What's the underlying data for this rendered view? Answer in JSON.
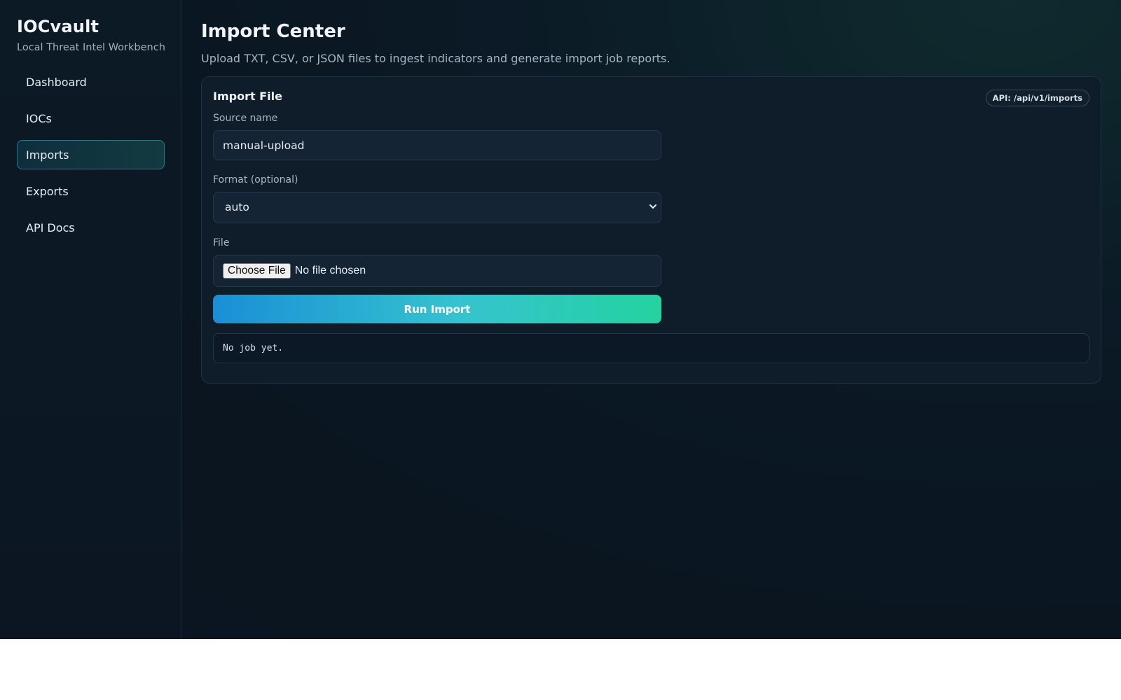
{
  "sidebar": {
    "brand": "IOCvault",
    "tagline": "Local Threat Intel Workbench",
    "items": [
      {
        "label": "Dashboard",
        "active": false
      },
      {
        "label": "IOCs",
        "active": false
      },
      {
        "label": "Imports",
        "active": true
      },
      {
        "label": "Exports",
        "active": false
      },
      {
        "label": "API Docs",
        "active": false
      }
    ]
  },
  "header": {
    "title": "Import Center",
    "subtitle": "Upload TXT, CSV, or JSON files to ingest indicators and generate import job reports."
  },
  "card": {
    "title": "Import File",
    "api_badge": "API: /api/v1/imports",
    "source_label": "Source name",
    "source_value": "manual-upload",
    "format_label": "Format (optional)",
    "format_value": "auto",
    "file_label": "File",
    "choose_file_label": "Choose File",
    "file_status": "No file chosen",
    "run_label": "Run Import",
    "job_output": "No job yet."
  },
  "icons": {
    "select_caret": "chevron-down-icon"
  }
}
